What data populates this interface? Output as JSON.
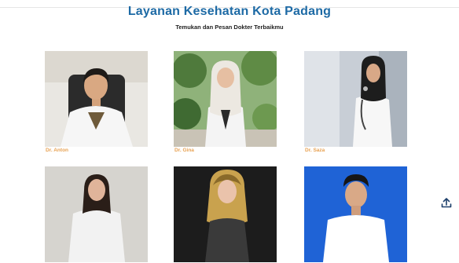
{
  "header": {
    "title": "Layanan Kesehatan Kota Padang",
    "subtitle": "Temukan dan Pesan Dokter Terbaikmu"
  },
  "doctors": [
    {
      "name": "Dr. Anton"
    },
    {
      "name": "Dr. Gina"
    },
    {
      "name": "Dr. Saza"
    },
    {
      "name": ""
    },
    {
      "name": ""
    },
    {
      "name": ""
    }
  ],
  "colors": {
    "title": "#1d6aa5",
    "doctor_name": "#e8a253"
  },
  "icons": {
    "scroll_top": "upload-icon"
  }
}
